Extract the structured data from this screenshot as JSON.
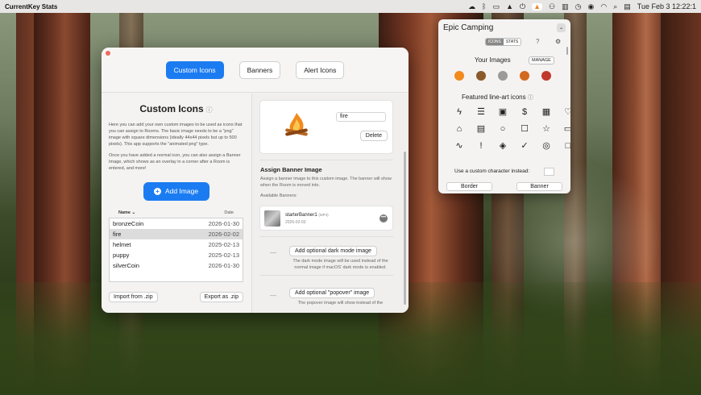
{
  "menubar": {
    "app_name": "CurrentKey Stats",
    "clock": "Tue Feb 3  12:22:1"
  },
  "window": {
    "tabs": [
      {
        "label": "Custom Icons",
        "active": true
      },
      {
        "label": "Banners",
        "active": false
      },
      {
        "label": "Alert Icons",
        "active": false
      }
    ],
    "left": {
      "title": "Custom Icons",
      "desc1": "Here you can add your own custom images to be used as icons that you can assign to Rooms. The basic image needs to be a \"png\" image with square dimensions (ideally 44x44 pixels but up to 500 pixels). This app supports the \"animated png\" type.",
      "desc2": "Once you have added a normal icon, you can also assign a Banner Image, which shows as an overlay in a corner after a Room is entered, and more!",
      "add_label": "Add Image",
      "col_name": "Name",
      "col_date": "Date",
      "rows": [
        {
          "name": "bronzeCoin",
          "date": "2026-01-30"
        },
        {
          "name": "fire",
          "date": "2026-02-02"
        },
        {
          "name": "helmet",
          "date": "2025-02-13"
        },
        {
          "name": "puppy",
          "date": "2025-02-13"
        },
        {
          "name": "silverCoin",
          "date": "2026-01-30"
        }
      ],
      "import_label": "Import from .zip",
      "export_label": "Export as .zip"
    },
    "right": {
      "image_name": "fire",
      "delete_label": "Delete",
      "banner_title": "Assign Banner Image",
      "banner_desc": "Assign a banner image to this custom image. The banner will show when the Room is moved into.",
      "available_label": "Available Banners:",
      "banner_name": "starterBanner1",
      "banner_tag": "(MP4)",
      "banner_date": "2026-02-03",
      "dark_btn": "Add optional dark mode image",
      "dark_desc": "The dark mode image will be used instead of the normal image if macOS' dark mode is enabled.",
      "popover_btn": "Add optional \"popover\" image",
      "popover_desc": "The popover image will show instead of the",
      "dash": "—"
    }
  },
  "popover": {
    "title": "Epic Camping",
    "seg_icons": "ICONS",
    "seg_stats": "STATS",
    "your_images": "Your Images",
    "manage": "MANAGE",
    "featured": "Featured line-art icons",
    "icons": [
      "ϟ",
      "☰",
      "▣",
      "$",
      "▦",
      "♡",
      "⌂",
      "▤",
      "○",
      "☐",
      "☆",
      "▭",
      "∿",
      "!",
      "◈",
      "✓",
      "◎",
      "□"
    ],
    "custom_char": "Use a custom character instead:",
    "border_btn": "Border",
    "banner_btn": "Banner"
  },
  "colors": {
    "accent": "#1b7cf2",
    "selected_row": "#dcdcdc"
  }
}
